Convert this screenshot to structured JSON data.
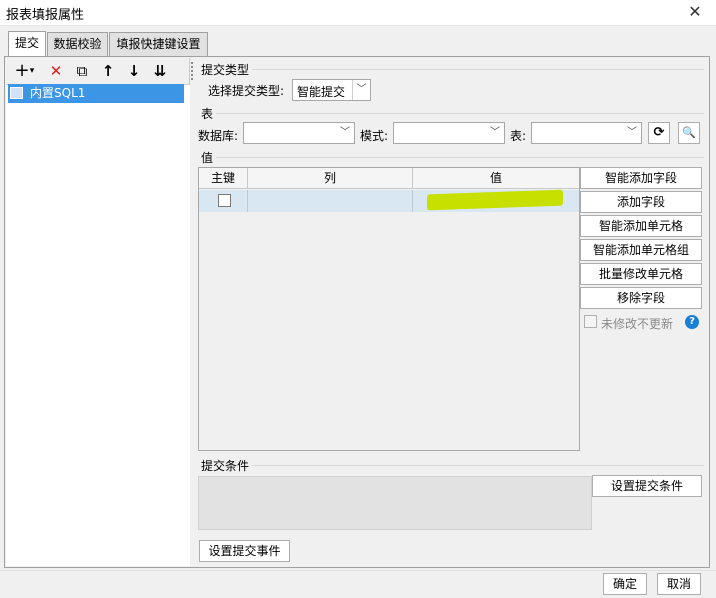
{
  "window": {
    "title": "报表填报属性",
    "close_glyph": "✕"
  },
  "tabs": [
    {
      "label": "提交"
    },
    {
      "label": "数据校验"
    },
    {
      "label": "填报快捷键设置"
    }
  ],
  "toolbar": {
    "add": "+",
    "add_arrow": "▾",
    "delete": "✕",
    "copy": "⧉",
    "up": "↑",
    "down": "↓",
    "move_bottom": "⇊"
  },
  "tree": {
    "items": [
      {
        "label": "内置SQL1"
      }
    ]
  },
  "submit_type": {
    "section": "提交类型",
    "label": "选择提交类型:",
    "value": "智能提交"
  },
  "table_section": {
    "section": "表",
    "db_label": "数据库:",
    "db_value": "",
    "schema_label": "模式:",
    "schema_value": "",
    "table_label": "表:",
    "table_value": "",
    "refresh_glyph": "⟳",
    "preview_glyph": "🔍"
  },
  "value_section": {
    "section": "值",
    "columns": [
      "主键",
      "列",
      "值"
    ],
    "rows": [
      {
        "pk": false,
        "column": "",
        "value": ""
      }
    ]
  },
  "side_buttons": {
    "smart_add_field": "智能添加字段",
    "add_field": "添加字段",
    "smart_add_cell": "智能添加单元格",
    "smart_add_cell_group": "智能添加单元格组",
    "batch_modify_cell": "批量修改单元格",
    "remove_field": "移除字段",
    "no_update_unmodified": "未修改不更新",
    "help": "?"
  },
  "condition": {
    "section": "提交条件",
    "set_condition": "设置提交条件",
    "set_event": "设置提交事件"
  },
  "footer": {
    "ok": "确定",
    "cancel": "取消"
  },
  "colors": {
    "selection": "#3d95e6",
    "row_highlight": "#d9e7f2",
    "delete_red": "#e02020",
    "help_blue": "#1a7fd6"
  }
}
